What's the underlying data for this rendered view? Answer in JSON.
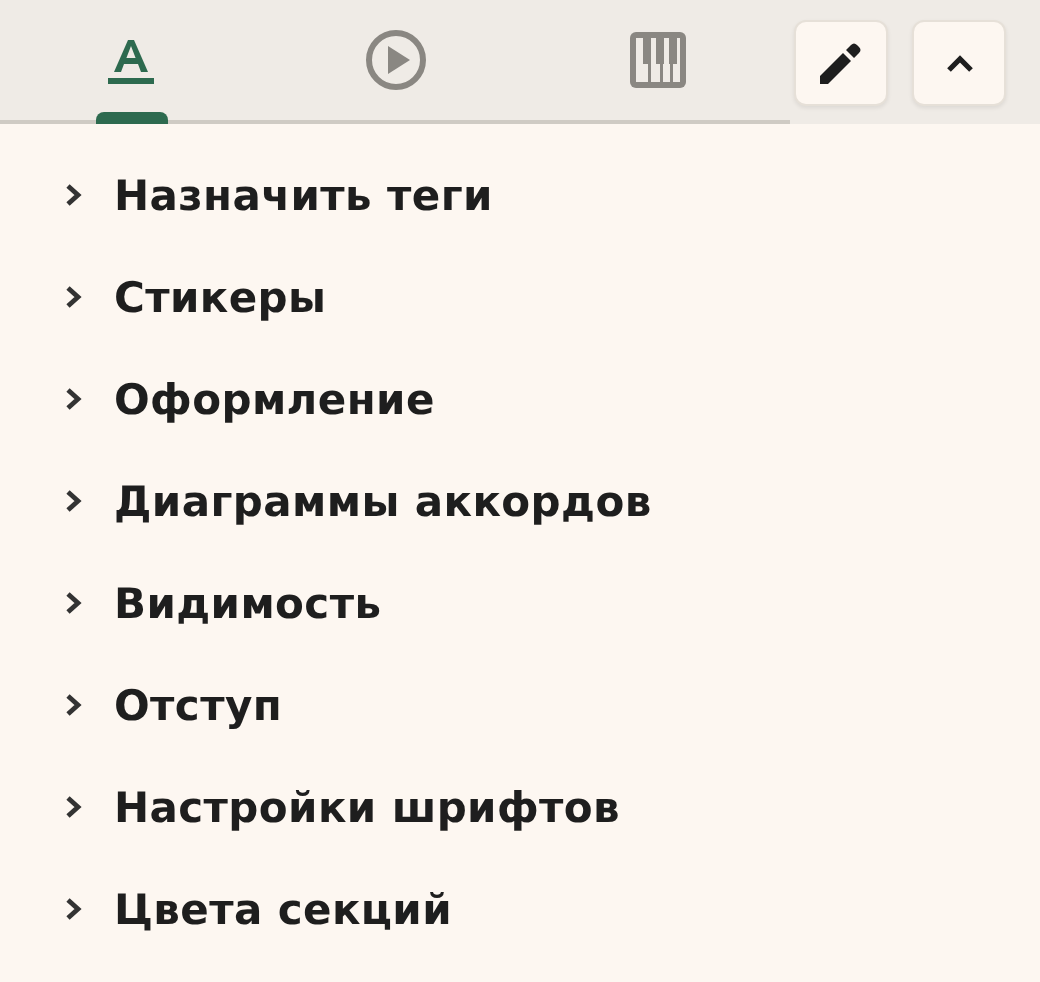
{
  "tabs": [
    {
      "kind": "text",
      "selected": true
    },
    {
      "kind": "play",
      "selected": false
    },
    {
      "kind": "piano",
      "selected": false
    }
  ],
  "toolbar_buttons": [
    {
      "kind": "edit"
    },
    {
      "kind": "collapse"
    }
  ],
  "sections": [
    {
      "label": "Назначить теги",
      "expanded": false
    },
    {
      "label": "Стикеры",
      "expanded": false
    },
    {
      "label": "Оформление",
      "expanded": false
    },
    {
      "label": "Диаграммы аккордов",
      "expanded": false
    },
    {
      "label": "Видимость",
      "expanded": false
    },
    {
      "label": "Отступ",
      "expanded": false
    },
    {
      "label": "Настройки шрифтов",
      "expanded": false
    },
    {
      "label": "Цвета секций",
      "expanded": false
    }
  ]
}
